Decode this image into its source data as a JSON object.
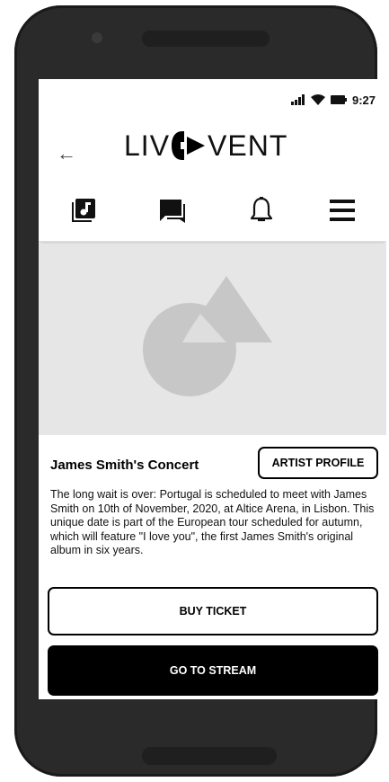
{
  "status": {
    "time": "9:27"
  },
  "header": {
    "back_icon": "arrow-left-icon",
    "logo_prefix": "LIV",
    "logo_mark": "speaker-mark-icon",
    "logo_suffix": "VENT"
  },
  "nav": {
    "icons": [
      "music-library-icon",
      "chat-icon",
      "bell-icon",
      "menu-icon"
    ]
  },
  "hero": {
    "image": "image-placeholder-icon"
  },
  "event": {
    "title": "James Smith's Concert",
    "artist_button": "ARTIST PROFILE",
    "description": "The long wait is over: Portugal is scheduled to meet with James Smith on 10th of November, 2020, at Altice Arena, in Lisbon. This unique date is part of the European tour scheduled for autumn, which will feature \"I love you\", the first James Smith's original album in six years."
  },
  "actions": {
    "buy_label": "BUY TICKET",
    "stream_label": "GO TO STREAM"
  }
}
